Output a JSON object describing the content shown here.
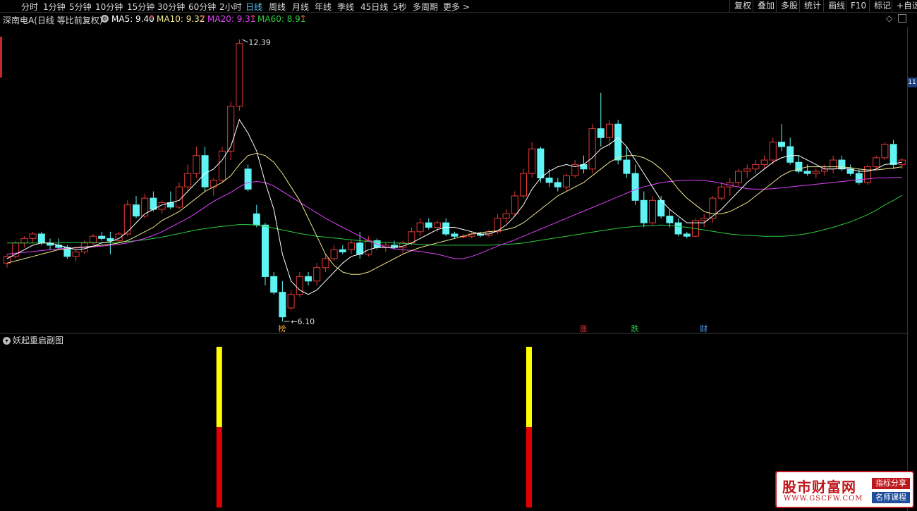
{
  "periods": [
    {
      "label": "分时"
    },
    {
      "label": "1分钟"
    },
    {
      "label": "5分钟"
    },
    {
      "label": "10分钟"
    },
    {
      "label": "15分钟"
    },
    {
      "label": "30分钟"
    },
    {
      "label": "60分钟"
    },
    {
      "label": "2小时"
    },
    {
      "label": "日线",
      "active": true
    },
    {
      "label": "周线"
    },
    {
      "label": "月线"
    },
    {
      "label": "年线"
    },
    {
      "label": "季线"
    },
    {
      "label": "45日线"
    },
    {
      "label": "5秒"
    },
    {
      "label": "多周期"
    },
    {
      "label": "更多 >"
    }
  ],
  "toolbar": [
    "复权",
    "叠加",
    "多股",
    "统计",
    "画线",
    "F10",
    "标记",
    "+自选"
  ],
  "info": {
    "stock_title": "深南电A(日线 等比前复权)",
    "ma5_label": "MA5: 9.40",
    "ma10_label": "MA10: 9.32",
    "ma20_label": "MA20: 9.31",
    "ma60_label": "MA60: 8.91",
    "ma5_color": "#ffffff",
    "ma10_color": "#f0e68c",
    "ma20_color": "#e040fb",
    "ma60_color": "#2ecc40"
  },
  "chart_data": {
    "type": "candlestick",
    "high_label": "12.39",
    "low_label": "6.10",
    "high_value": 12.39,
    "low_value": 6.1,
    "up_color": "#e53935",
    "down_color": "#5ff3f3",
    "candles": [
      [
        7.4,
        7.6,
        7.3,
        7.55
      ],
      [
        7.55,
        7.9,
        7.5,
        7.85
      ],
      [
        7.85,
        8.0,
        7.75,
        7.95
      ],
      [
        7.95,
        8.1,
        7.85,
        8.05
      ],
      [
        8.05,
        8.1,
        7.8,
        7.85
      ],
      [
        7.85,
        7.95,
        7.7,
        7.8
      ],
      [
        7.8,
        7.95,
        7.7,
        7.75
      ],
      [
        7.75,
        7.8,
        7.5,
        7.55
      ],
      [
        7.55,
        7.7,
        7.45,
        7.65
      ],
      [
        7.65,
        7.9,
        7.6,
        7.85
      ],
      [
        7.85,
        8.05,
        7.8,
        8.0
      ],
      [
        8.0,
        8.1,
        7.9,
        7.95
      ],
      [
        7.95,
        8.1,
        7.6,
        7.9
      ],
      [
        7.9,
        8.1,
        7.85,
        8.05
      ],
      [
        8.05,
        8.8,
        8.0,
        8.7
      ],
      [
        8.7,
        8.9,
        8.4,
        8.45
      ],
      [
        8.45,
        8.95,
        8.4,
        8.85
      ],
      [
        8.85,
        9.0,
        8.55,
        8.6
      ],
      [
        8.6,
        8.8,
        8.5,
        8.75
      ],
      [
        8.75,
        9.0,
        8.6,
        8.65
      ],
      [
        8.65,
        9.2,
        8.6,
        9.1
      ],
      [
        9.1,
        9.6,
        9.0,
        9.4
      ],
      [
        9.4,
        10.0,
        9.3,
        9.8
      ],
      [
        9.8,
        10.0,
        9.0,
        9.1
      ],
      [
        9.1,
        9.3,
        8.9,
        9.25
      ],
      [
        9.25,
        10.0,
        9.2,
        9.9
      ],
      [
        9.9,
        11.0,
        9.7,
        10.9
      ],
      [
        10.9,
        12.39,
        10.8,
        12.3
      ],
      [
        9.5,
        9.6,
        9.0,
        9.05
      ],
      [
        8.5,
        8.7,
        8.2,
        8.25
      ],
      [
        8.25,
        8.3,
        6.9,
        7.1
      ],
      [
        7.1,
        7.2,
        6.7,
        6.75
      ],
      [
        6.75,
        7.0,
        6.1,
        6.2
      ],
      [
        6.4,
        6.8,
        6.35,
        6.7
      ],
      [
        6.7,
        7.2,
        6.65,
        7.1
      ],
      [
        7.1,
        7.2,
        6.9,
        7.0
      ],
      [
        7.0,
        7.4,
        6.9,
        7.3
      ],
      [
        7.3,
        7.6,
        7.2,
        7.5
      ],
      [
        7.5,
        7.8,
        7.45,
        7.7
      ],
      [
        7.7,
        7.8,
        7.6,
        7.65
      ],
      [
        7.7,
        7.9,
        7.6,
        7.85
      ],
      [
        7.85,
        8.1,
        7.5,
        7.6
      ],
      [
        7.6,
        8.0,
        7.55,
        7.9
      ],
      [
        7.9,
        7.95,
        7.7,
        7.75
      ],
      [
        7.75,
        7.85,
        7.65,
        7.8
      ],
      [
        7.8,
        7.9,
        7.7,
        7.75
      ],
      [
        7.75,
        7.9,
        7.6,
        7.85
      ],
      [
        7.85,
        8.2,
        7.8,
        8.1
      ],
      [
        8.1,
        8.4,
        8.0,
        8.3
      ],
      [
        8.3,
        8.4,
        8.15,
        8.2
      ],
      [
        8.2,
        8.35,
        8.1,
        8.3
      ],
      [
        8.3,
        8.4,
        8.0,
        8.05
      ],
      [
        8.05,
        8.1,
        7.95,
        8.0
      ],
      [
        8.0,
        8.05,
        7.95,
        8.0
      ],
      [
        8.0,
        8.1,
        7.95,
        8.05
      ],
      [
        8.05,
        8.1,
        7.98,
        8.02
      ],
      [
        8.02,
        8.15,
        7.98,
        8.1
      ],
      [
        8.1,
        8.5,
        8.05,
        8.4
      ],
      [
        8.4,
        8.6,
        8.3,
        8.5
      ],
      [
        8.5,
        9.0,
        8.45,
        8.9
      ],
      [
        8.9,
        9.5,
        8.85,
        9.4
      ],
      [
        9.4,
        10.1,
        9.3,
        9.95
      ],
      [
        9.95,
        10.0,
        9.2,
        9.3
      ],
      [
        9.3,
        9.5,
        9.1,
        9.2
      ],
      [
        9.2,
        9.3,
        9.0,
        9.1
      ],
      [
        9.1,
        9.4,
        9.0,
        9.35
      ],
      [
        9.35,
        9.7,
        9.3,
        9.6
      ],
      [
        9.6,
        9.8,
        9.4,
        9.5
      ],
      [
        9.5,
        10.5,
        9.4,
        10.4
      ],
      [
        10.4,
        11.2,
        10.0,
        10.2
      ],
      [
        10.2,
        10.6,
        10.0,
        10.5
      ],
      [
        10.5,
        10.6,
        9.6,
        9.7
      ],
      [
        9.7,
        10.0,
        9.3,
        9.4
      ],
      [
        9.4,
        9.6,
        8.7,
        8.8
      ],
      [
        8.8,
        9.0,
        8.2,
        8.3
      ],
      [
        8.3,
        8.9,
        8.25,
        8.8
      ],
      [
        8.8,
        8.9,
        8.4,
        8.45
      ],
      [
        8.45,
        8.6,
        8.2,
        8.3
      ],
      [
        8.3,
        8.4,
        8.0,
        8.05
      ],
      [
        8.05,
        8.1,
        7.95,
        8.0
      ],
      [
        8.0,
        8.4,
        7.98,
        8.35
      ],
      [
        8.35,
        8.5,
        8.2,
        8.4
      ],
      [
        8.4,
        8.9,
        8.3,
        8.85
      ],
      [
        8.85,
        9.2,
        8.8,
        9.1
      ],
      [
        9.1,
        9.3,
        8.9,
        9.2
      ],
      [
        9.2,
        9.5,
        9.1,
        9.45
      ],
      [
        9.45,
        9.6,
        9.3,
        9.5
      ],
      [
        9.5,
        9.7,
        9.4,
        9.6
      ],
      [
        9.6,
        9.8,
        9.5,
        9.7
      ],
      [
        9.7,
        10.2,
        9.6,
        10.1
      ],
      [
        10.1,
        10.5,
        9.9,
        10.0
      ],
      [
        10.0,
        10.2,
        9.6,
        9.65
      ],
      [
        9.65,
        9.8,
        9.4,
        9.45
      ],
      [
        9.45,
        9.6,
        9.35,
        9.4
      ],
      [
        9.4,
        9.5,
        9.3,
        9.45
      ],
      [
        9.45,
        9.6,
        9.35,
        9.5
      ],
      [
        9.5,
        9.8,
        9.4,
        9.7
      ],
      [
        9.7,
        9.8,
        9.45,
        9.5
      ],
      [
        9.5,
        9.6,
        9.35,
        9.4
      ],
      [
        9.4,
        9.5,
        9.15,
        9.2
      ],
      [
        9.2,
        9.6,
        9.15,
        9.55
      ],
      [
        9.55,
        9.8,
        9.5,
        9.75
      ],
      [
        9.75,
        10.1,
        9.7,
        10.05
      ],
      [
        10.05,
        10.15,
        9.5,
        9.6
      ],
      [
        9.6,
        9.75,
        9.5,
        9.7
      ]
    ],
    "ma5": [
      7.5,
      7.6,
      7.7,
      7.8,
      7.85,
      7.85,
      7.8,
      7.75,
      7.7,
      7.72,
      7.78,
      7.85,
      7.88,
      7.95,
      8.1,
      8.3,
      8.5,
      8.6,
      8.7,
      8.75,
      8.8,
      9.0,
      9.2,
      9.4,
      9.5,
      9.7,
      10.0,
      10.6,
      10.3,
      9.9,
      9.2,
      8.6,
      7.6,
      7.0,
      6.8,
      6.7,
      6.8,
      7.0,
      7.2,
      7.4,
      7.55,
      7.6,
      7.7,
      7.75,
      7.75,
      7.75,
      7.78,
      7.85,
      7.95,
      8.05,
      8.15,
      8.2,
      8.2,
      8.15,
      8.1,
      8.05,
      8.05,
      8.12,
      8.25,
      8.45,
      8.7,
      9.05,
      9.3,
      9.45,
      9.55,
      9.6,
      9.55,
      9.6,
      9.75,
      9.95,
      10.05,
      10.2,
      10.0,
      9.7,
      9.4,
      9.1,
      8.8,
      8.6,
      8.45,
      8.3,
      8.3,
      8.3,
      8.45,
      8.6,
      8.8,
      9.0,
      9.2,
      9.35,
      9.5,
      9.65,
      9.75,
      9.8,
      9.8,
      9.7,
      9.6,
      9.5,
      9.5,
      9.52,
      9.5,
      9.45,
      9.45,
      9.5,
      9.6,
      9.62,
      9.65
    ],
    "ma10": [
      7.4,
      7.45,
      7.5,
      7.55,
      7.6,
      7.65,
      7.7,
      7.72,
      7.75,
      7.76,
      7.78,
      7.8,
      7.82,
      7.85,
      7.9,
      8.0,
      8.1,
      8.2,
      8.35,
      8.45,
      8.55,
      8.7,
      8.85,
      9.0,
      9.1,
      9.2,
      9.35,
      9.6,
      9.8,
      9.85,
      9.8,
      9.65,
      9.4,
      9.1,
      8.8,
      8.4,
      8.0,
      7.6,
      7.35,
      7.2,
      7.15,
      7.15,
      7.2,
      7.3,
      7.4,
      7.5,
      7.6,
      7.68,
      7.75,
      7.8,
      7.85,
      7.9,
      7.95,
      8.0,
      8.05,
      8.08,
      8.1,
      8.12,
      8.15,
      8.2,
      8.3,
      8.45,
      8.6,
      8.75,
      8.9,
      9.0,
      9.1,
      9.2,
      9.35,
      9.5,
      9.65,
      9.75,
      9.8,
      9.8,
      9.75,
      9.65,
      9.5,
      9.3,
      9.05,
      8.85,
      8.7,
      8.55,
      8.5,
      8.5,
      8.55,
      8.65,
      8.75,
      8.9,
      9.05,
      9.2,
      9.35,
      9.45,
      9.5,
      9.55,
      9.55,
      9.55,
      9.55,
      9.55,
      9.53,
      9.5,
      9.48,
      9.48,
      9.5,
      9.52,
      9.55
    ],
    "ma20": [
      7.6,
      7.62,
      7.64,
      7.66,
      7.68,
      7.7,
      7.72,
      7.73,
      7.74,
      7.75,
      7.76,
      7.78,
      7.8,
      7.82,
      7.85,
      7.9,
      7.95,
      8.02,
      8.1,
      8.2,
      8.3,
      8.4,
      8.52,
      8.65,
      8.78,
      8.88,
      8.98,
      9.1,
      9.2,
      9.22,
      9.2,
      9.12,
      9.0,
      8.88,
      8.76,
      8.64,
      8.52,
      8.4,
      8.3,
      8.2,
      8.1,
      8.0,
      7.9,
      7.82,
      7.76,
      7.72,
      7.7,
      7.68,
      7.66,
      7.63,
      7.6,
      7.55,
      7.5,
      7.5,
      7.55,
      7.62,
      7.7,
      7.78,
      7.85,
      7.92,
      8.0,
      8.08,
      8.16,
      8.24,
      8.32,
      8.4,
      8.48,
      8.56,
      8.64,
      8.72,
      8.8,
      8.88,
      8.96,
      9.04,
      9.1,
      9.15,
      9.2,
      9.22,
      9.24,
      9.25,
      9.25,
      9.24,
      9.22,
      9.18,
      9.14,
      9.1,
      9.06,
      9.05,
      9.05,
      9.06,
      9.08,
      9.1,
      9.12,
      9.14,
      9.16,
      9.18,
      9.2,
      9.22,
      9.24,
      9.26,
      9.28,
      9.3,
      9.3,
      9.31,
      9.31
    ],
    "ma60": [
      7.85,
      7.85,
      7.85,
      7.85,
      7.85,
      7.85,
      7.85,
      7.86,
      7.86,
      7.86,
      7.86,
      7.86,
      7.86,
      7.87,
      7.88,
      7.9,
      7.92,
      7.95,
      7.98,
      8.02,
      8.06,
      8.1,
      8.14,
      8.17,
      8.2,
      8.22,
      8.24,
      8.26,
      8.26,
      8.25,
      8.22,
      8.18,
      8.14,
      8.1,
      8.06,
      8.03,
      8.0,
      7.98,
      7.96,
      7.94,
      7.92,
      7.9,
      7.88,
      7.87,
      7.86,
      7.85,
      7.84,
      7.83,
      7.82,
      7.81,
      7.8,
      7.8,
      7.8,
      7.8,
      7.8,
      7.8,
      7.8,
      7.81,
      7.82,
      7.83,
      7.85,
      7.88,
      7.91,
      7.94,
      7.97,
      8.0,
      8.03,
      8.06,
      8.09,
      8.12,
      8.15,
      8.18,
      8.2,
      8.22,
      8.23,
      8.24,
      8.25,
      8.24,
      8.22,
      8.2,
      8.17,
      8.14,
      8.11,
      8.08,
      8.05,
      8.03,
      8.02,
      8.01,
      8.0,
      8.0,
      8.0,
      8.01,
      8.03,
      8.06,
      8.1,
      8.15,
      8.2,
      8.26,
      8.32,
      8.4,
      8.48,
      8.58,
      8.7,
      8.8,
      8.91
    ],
    "markers": [
      {
        "index": 32,
        "text": "榜",
        "color": "#e6a23c"
      },
      {
        "index": 67,
        "text": "涨",
        "color": "#e53935"
      },
      {
        "index": 73,
        "text": "跌",
        "color": "#2ecc40"
      },
      {
        "index": 81,
        "text": "财",
        "color": "#4fa3f7"
      }
    ]
  },
  "sub_chart": {
    "title": "妖起重启副图",
    "bars": [
      {
        "index": 24,
        "yellow_frac": 0.5,
        "red_frac": 0.5
      },
      {
        "index": 60,
        "yellow_frac": 0.5,
        "red_frac": 0.5
      }
    ],
    "yellow": "#ffff00",
    "red": "#e00000"
  },
  "right_scale_label": "11",
  "watermark": {
    "title": "股市财富网",
    "url": "WWW.GSCFW.COM",
    "tag1": "指标分享",
    "tag2": "名师课程"
  }
}
